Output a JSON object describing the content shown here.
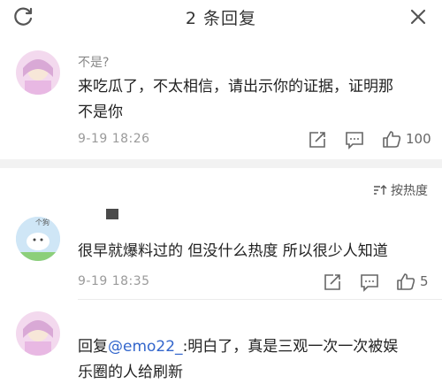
{
  "header": {
    "title": "2 条回复"
  },
  "sort": {
    "label": "按热度"
  },
  "comments": [
    {
      "username": "不是?",
      "text": "来吃瓜了，不太相信，请出示你的证据，证明那不是你",
      "line1": "来吃瓜了，不太相信，请出示你的证据，证明那",
      "line2": "不是你",
      "time": "9-19 18:26",
      "likes": "100"
    },
    {
      "username": "",
      "text": "很早就爆料过的 但没什么热度 所以很少人知道",
      "time": "9-19 18:35",
      "likes": "5",
      "avatar_label": "个狗"
    },
    {
      "username": "",
      "reply_prefix": "回复",
      "mention": "@emo22_",
      "line1_rest": ":明白了，真是三观一次一次被娱",
      "line2": "乐圈的人给刷新"
    }
  ],
  "colors": {
    "divider": "#f2f2f2",
    "mention": "#3366cc",
    "meta": "#9a9a9a"
  },
  "icons": [
    "refresh-icon",
    "close-icon",
    "share-icon",
    "comment-icon",
    "like-icon",
    "sort-icon"
  ]
}
